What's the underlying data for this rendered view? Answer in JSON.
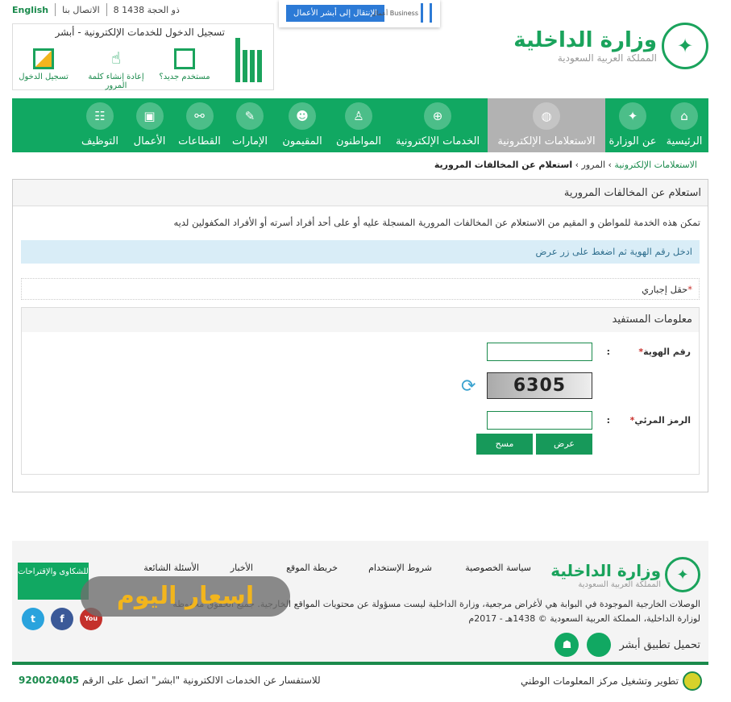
{
  "topbar": {
    "english": "English",
    "contact": "الاتصال بنا",
    "date": "8 ذو الحجة 1438"
  },
  "absher": {
    "title": "تسجيل الدخول للخدمات الإلكترونية - أبشر",
    "new_user": "مستخدم جديد؟",
    "reset_password": "إعادة إنشاء كلمة المرور",
    "login": "تسجيل الدخول"
  },
  "business": {
    "button": "الإنتقال إلى أبشر الأعمال",
    "logo_text": "أعمال Business"
  },
  "ministry": {
    "name": "وزارة الداخلية",
    "country": "المملكة العربية السعودية"
  },
  "nav": [
    {
      "label": "الرئيسية",
      "icon": "home-icon"
    },
    {
      "label": "عن الوزارة",
      "icon": "emblem-icon"
    },
    {
      "label": "الاستعلامات الإلكترونية",
      "icon": "globe-query-icon",
      "active": true
    },
    {
      "label": "الخدمات الإلكترونية",
      "icon": "globe-icon"
    },
    {
      "label": "المواطنون",
      "icon": "citizen-icon"
    },
    {
      "label": "المقيمون",
      "icon": "residents-icon"
    },
    {
      "label": "الإمارات",
      "icon": "emirates-icon"
    },
    {
      "label": "القطاعات",
      "icon": "sectors-icon"
    },
    {
      "label": "الأعمال",
      "icon": "briefcase-icon"
    },
    {
      "label": "التوظيف",
      "icon": "employment-icon"
    }
  ],
  "breadcrumb": {
    "level1": "الاستعلامات الإلكترونية",
    "level2": "المرور",
    "current": "استعلام عن المخالفات المرورية"
  },
  "panel": {
    "title": "استعلام عن المخالفات المرورية",
    "description": "تمكن هذه الخدمة للمواطن و المقيم من الاستعلام عن المخالفات المرورية المسجلة عليه أو على أحد أفراد أسرته أو الأفراد المكفولين لديه",
    "info": "ادخل رقم الهوية ثم اضغط على زر عرض",
    "required_note": "حقل إجباري",
    "section_title": "معلومات المستفيد",
    "id_label": "رقم الهوية",
    "id_value": "",
    "captcha_text": "6305",
    "code_label": "الرمز المرئي",
    "code_value": "",
    "colon": ":",
    "submit": "عرض",
    "clear": "مسح"
  },
  "footer": {
    "links": [
      "سياسة الخصوصية",
      "شروط الإستخدام",
      "خريطة الموقع",
      "الأخبار",
      "الأسئلة الشائعة"
    ],
    "disclaimer": "الوصلات الخارجية الموجودة في البوابة هي لأغراض مرجعية، وزارة الداخلية ليست مسؤولة عن محتويات المواقع الخارجية. جميع الحقوق محفوظة لوزارة الداخلية، المملكة العربية السعودية © 1438هـ - 2017م",
    "app": "تحميل تطبيق أبشر",
    "complaints": "للشكاوى والإقتراحات",
    "watermark": "اسعار اليوم",
    "developer": "تطوير وتشغيل مركز المعلومات الوطني",
    "inquiry": "للاستفسار عن الخدمات الالكترونية \"ابشر\" اتصل على الرقم",
    "phone": "920020405"
  },
  "colors": {
    "green": "#11a862",
    "active_nav": "#b2b2b2",
    "info_bg": "#d9edf7",
    "business_blue": "#2c7ad6"
  }
}
